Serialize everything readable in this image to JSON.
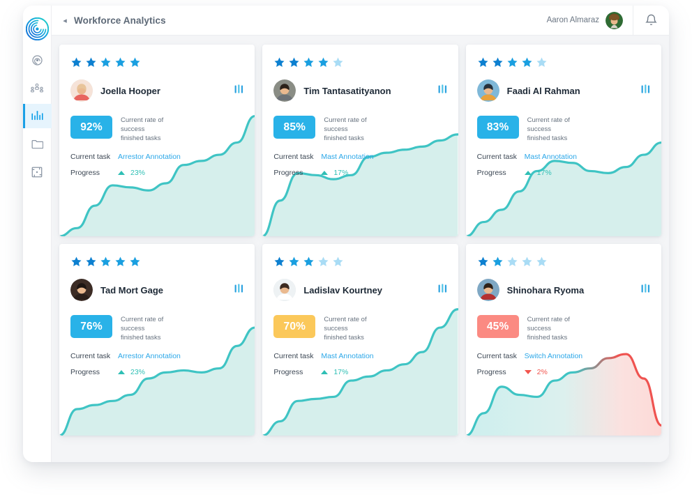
{
  "app": {
    "logo_icon": "spiral-logo-icon"
  },
  "sidebar": {
    "items": [
      {
        "icon": "wifi-spiral-icon",
        "name": "sidebar-item-signal",
        "active": false
      },
      {
        "icon": "org-chart-people-icon",
        "name": "sidebar-item-teams",
        "active": false
      },
      {
        "icon": "bar-chart-analytics-icon",
        "name": "sidebar-item-analytics",
        "active": true
      },
      {
        "icon": "folder-icon",
        "name": "sidebar-item-files",
        "active": false
      },
      {
        "icon": "frame-crop-icon",
        "name": "sidebar-item-workspace",
        "active": false
      }
    ]
  },
  "header": {
    "back_label": "◂",
    "title": "Workforce Analytics",
    "user_name": "Aaron Almaraz",
    "avatar_icon": "user-avatar",
    "bell_icon": "bell-icon"
  },
  "labels": {
    "rate_line1": "Current rate of",
    "rate_line2": "success",
    "rate_line3": "finished tasks",
    "current_task": "Current task",
    "progress": "Progress",
    "menu_icon": "equalizer-icon"
  },
  "colors": {
    "badge_blue": "#29b2e8",
    "badge_yellow": "#fbc85a",
    "badge_red": "#fb8a82",
    "star_filled_dark": "#0d80d0",
    "star_filled_mid": "#1a9fe0",
    "star_empty": "#a9dcf5",
    "link": "#2ba7e8",
    "spark_line": "#3fc4c4",
    "spark_fill": "#d6efec",
    "spark_line_red": "#ef5350",
    "progress_up": "#2fbfb5",
    "progress_down": "#f2554e",
    "accent": "#1aa0e6"
  },
  "cards": [
    {
      "name": "Joella Hooper",
      "stars": 5,
      "rating_max": 5,
      "percent": "92%",
      "badge_color": "badge_blue",
      "task": "Arrestor Annotation",
      "progress_value": "23%",
      "progress_direction": "up",
      "avatar_hair": "#e8c49a",
      "avatar_bg": "#f6e3d8",
      "avatar_shirt": "#e8655f",
      "chart": {
        "type": "area",
        "points": [
          0,
          8,
          30,
          50,
          48,
          45,
          52,
          70,
          74,
          80,
          92,
          118
        ],
        "ymax": 130,
        "trend": "rising",
        "color": "spark_line"
      }
    },
    {
      "name": "Tim Tantasatityanon",
      "stars": 4,
      "rating_max": 5,
      "percent": "85%",
      "badge_color": "badge_blue",
      "task": "Mast Annotation",
      "progress_value": "17%",
      "progress_direction": "up",
      "avatar_hair": "#2b2119",
      "avatar_bg": "#8a8d85",
      "avatar_shirt": "#6d7277",
      "chart": {
        "type": "area",
        "points": [
          0,
          35,
          62,
          60,
          56,
          60,
          78,
          82,
          85,
          88,
          94,
          100
        ],
        "ymax": 130,
        "trend": "rising",
        "color": "spark_line"
      }
    },
    {
      "name": "Faadi Al Rahman",
      "stars": 4,
      "rating_max": 5,
      "percent": "83%",
      "badge_color": "badge_blue",
      "task": "Mast Annotation",
      "progress_value": "17%",
      "progress_direction": "up",
      "avatar_hair": "#26313c",
      "avatar_bg": "#7fb8d8",
      "avatar_shirt": "#e8a13c",
      "chart": {
        "type": "area",
        "points": [
          0,
          14,
          26,
          44,
          64,
          74,
          72,
          64,
          62,
          68,
          80,
          92
        ],
        "ymax": 130,
        "trend": "rising",
        "color": "spark_line"
      }
    },
    {
      "name": "Tad Mort Gage",
      "stars": 5,
      "rating_max": 5,
      "percent": "76%",
      "badge_color": "badge_blue",
      "task": "Arrestor Annotation",
      "progress_value": "23%",
      "progress_direction": "up",
      "avatar_hair": "#1d1512",
      "avatar_bg": "#3c2c25",
      "avatar_shirt": "#2a1f1a",
      "chart": {
        "type": "area",
        "points": [
          0,
          26,
          30,
          34,
          40,
          56,
          62,
          64,
          62,
          66,
          88,
          106
        ],
        "ymax": 130,
        "trend": "rising",
        "color": "spark_line"
      }
    },
    {
      "name": "Ladislav Kourtney",
      "stars": 3,
      "rating_max": 5,
      "percent": "70%",
      "badge_color": "badge_yellow",
      "task": "Mast Annotation",
      "progress_value": "17%",
      "progress_direction": "up",
      "avatar_hair": "#3c2a20",
      "avatar_bg": "#eef2f4",
      "avatar_shirt": "#ffffff",
      "chart": {
        "type": "area",
        "points": [
          0,
          14,
          34,
          36,
          38,
          54,
          58,
          64,
          70,
          82,
          106,
          124
        ],
        "ymax": 130,
        "trend": "rising",
        "color": "spark_line"
      }
    },
    {
      "name": "Shinohara Ryoma",
      "stars": 2,
      "rating_max": 5,
      "percent": "45%",
      "badge_color": "badge_red",
      "task": "Switch Annotation",
      "progress_value": "2%",
      "progress_direction": "down",
      "avatar_hair": "#2e2118",
      "avatar_bg": "#7fa8c4",
      "avatar_shirt": "#b5302f",
      "chart": {
        "type": "area",
        "points": [
          0,
          22,
          48,
          40,
          38,
          54,
          62,
          66,
          76,
          80,
          56,
          10
        ],
        "ymax": 130,
        "trend": "falling",
        "color": "spark_line_red"
      }
    }
  ]
}
